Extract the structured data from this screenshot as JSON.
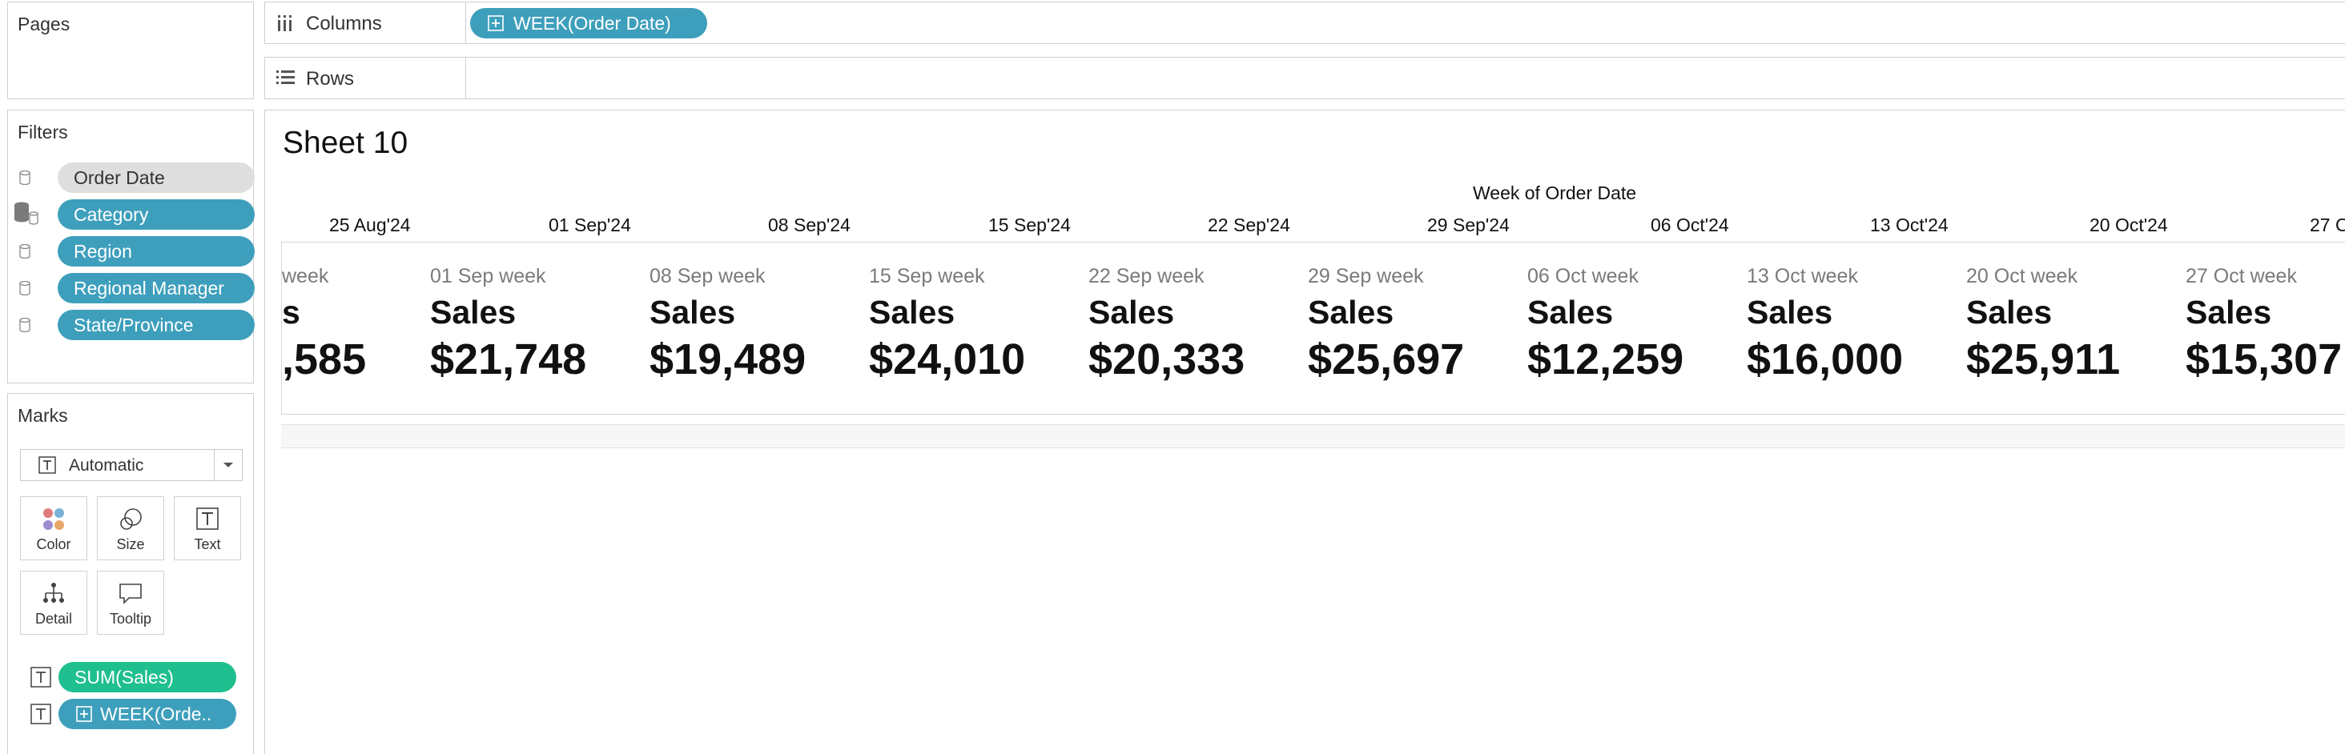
{
  "left_panel": {
    "pages_title": "Pages",
    "filters_title": "Filters",
    "filters": [
      {
        "label": "Order Date",
        "style": "gray"
      },
      {
        "label": "Category",
        "style": "blue"
      },
      {
        "label": "Region",
        "style": "blue"
      },
      {
        "label": "Regional Manager",
        "style": "blue"
      },
      {
        "label": "State/Province",
        "style": "blue"
      }
    ],
    "marks_title": "Marks",
    "mark_type": "Automatic",
    "mark_buttons": {
      "color": "Color",
      "size": "Size",
      "text": "Text",
      "detail": "Detail",
      "tooltip": "Tooltip"
    },
    "mark_fields": [
      {
        "label": "SUM(Sales)",
        "style": "green"
      },
      {
        "label": "WEEK(Orde..",
        "style": "blue"
      }
    ]
  },
  "shelves": {
    "columns_label": "Columns",
    "columns_pill": "WEEK(Order Date)",
    "rows_label": "Rows"
  },
  "view": {
    "sheet_title": "Sheet 10",
    "axis_title": "Week of Order Date",
    "ticks": [
      "25 Aug'24",
      "01 Sep'24",
      "08 Sep'24",
      "15 Sep'24",
      "22 Sep'24",
      "29 Sep'24",
      "06 Oct'24",
      "13 Oct'24",
      "20 Oct'24",
      "27 O"
    ],
    "cards": [
      {
        "week": "week",
        "measure": "s",
        "value": ",585"
      },
      {
        "week": "01 Sep week",
        "measure": "Sales",
        "value": "$21,748"
      },
      {
        "week": "08 Sep week",
        "measure": "Sales",
        "value": "$19,489"
      },
      {
        "week": "15 Sep week",
        "measure": "Sales",
        "value": "$24,010"
      },
      {
        "week": "22 Sep week",
        "measure": "Sales",
        "value": "$20,333"
      },
      {
        "week": "29 Sep week",
        "measure": "Sales",
        "value": "$25,697"
      },
      {
        "week": "06 Oct week",
        "measure": "Sales",
        "value": "$12,259"
      },
      {
        "week": "13 Oct week",
        "measure": "Sales",
        "value": "$16,000"
      },
      {
        "week": "20 Oct week",
        "measure": "Sales",
        "value": "$25,911"
      },
      {
        "week": "27 Oct week",
        "measure": "Sales",
        "value": "$15,307"
      }
    ]
  },
  "colors": {
    "dimension_pill": "#3e9fbc",
    "measure_pill": "#1fbf8f",
    "filter_gray_pill": "#dedede"
  }
}
